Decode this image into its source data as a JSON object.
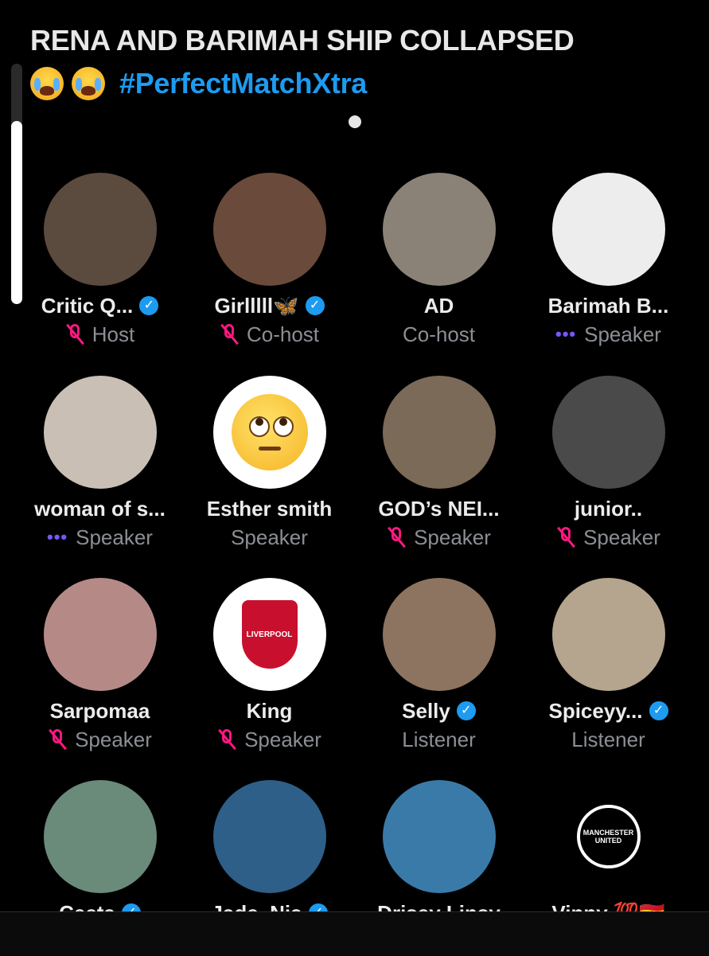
{
  "title": {
    "line1": "RENA AND BARIMAH SHIP COLLAPSED",
    "emojis": [
      "crying-face",
      "crying-face"
    ],
    "hashtag": "#PerfectMatchXtra"
  },
  "participants": [
    {
      "name": "Critic Q...",
      "verified": true,
      "role": "Host",
      "status": "muted",
      "avatar_color": "#5b4a3e"
    },
    {
      "name": "Girlllll🦋",
      "verified": true,
      "role": "Co-host",
      "status": "muted",
      "avatar_color": "#6a4a3a"
    },
    {
      "name": "AD",
      "verified": false,
      "role": "Co-host",
      "status": "none",
      "avatar_color": "#8a8276"
    },
    {
      "name": "Barimah B...",
      "verified": false,
      "role": "Speaker",
      "status": "speaking",
      "avatar_color": "#ededed"
    },
    {
      "name": "woman of s...",
      "verified": false,
      "role": "Speaker",
      "status": "speaking",
      "avatar_color": "#c9bfb4"
    },
    {
      "name": "Esther smith",
      "verified": false,
      "role": "Speaker",
      "status": "none",
      "avatar_color": "#ffffff"
    },
    {
      "name": "GOD’s NEI...",
      "verified": false,
      "role": "Speaker",
      "status": "muted",
      "avatar_color": "#7b6a58"
    },
    {
      "name": "junior..",
      "verified": false,
      "role": "Speaker",
      "status": "muted",
      "avatar_color": "#4a4a4a"
    },
    {
      "name": "Sarpomaa",
      "verified": false,
      "role": "Speaker",
      "status": "muted",
      "avatar_color": "#b58a86"
    },
    {
      "name": "King",
      "verified": false,
      "role": "Speaker",
      "status": "muted",
      "avatar_color": "#ffffff"
    },
    {
      "name": "Selly",
      "verified": true,
      "role": "Listener",
      "status": "none",
      "avatar_color": "#8d7460"
    },
    {
      "name": "Spiceyy...",
      "verified": true,
      "role": "Listener",
      "status": "none",
      "avatar_color": "#b5a48e"
    },
    {
      "name": "Ceeta",
      "verified": true,
      "role": "",
      "status": "none",
      "avatar_color": "#6a8a7a"
    },
    {
      "name": "Jade_Nia",
      "verified": true,
      "role": "",
      "status": "none",
      "avatar_color": "#2d5f88"
    },
    {
      "name": "Drisey Linsy",
      "verified": false,
      "role": "",
      "status": "none",
      "avatar_color": "#3a7aa8"
    },
    {
      "name": "Vinny 💯🇬🇭",
      "verified": false,
      "role": "",
      "status": "none",
      "avatar_color": "#000000"
    }
  ],
  "crests": {
    "liverpool": "LIVERPOOL",
    "manchester": "MANCHESTER UNITED"
  },
  "colors": {
    "verified": "#1d9bf0",
    "muted": "#f91880",
    "speaking": "#7856ff",
    "role_text": "#8b8f94"
  }
}
